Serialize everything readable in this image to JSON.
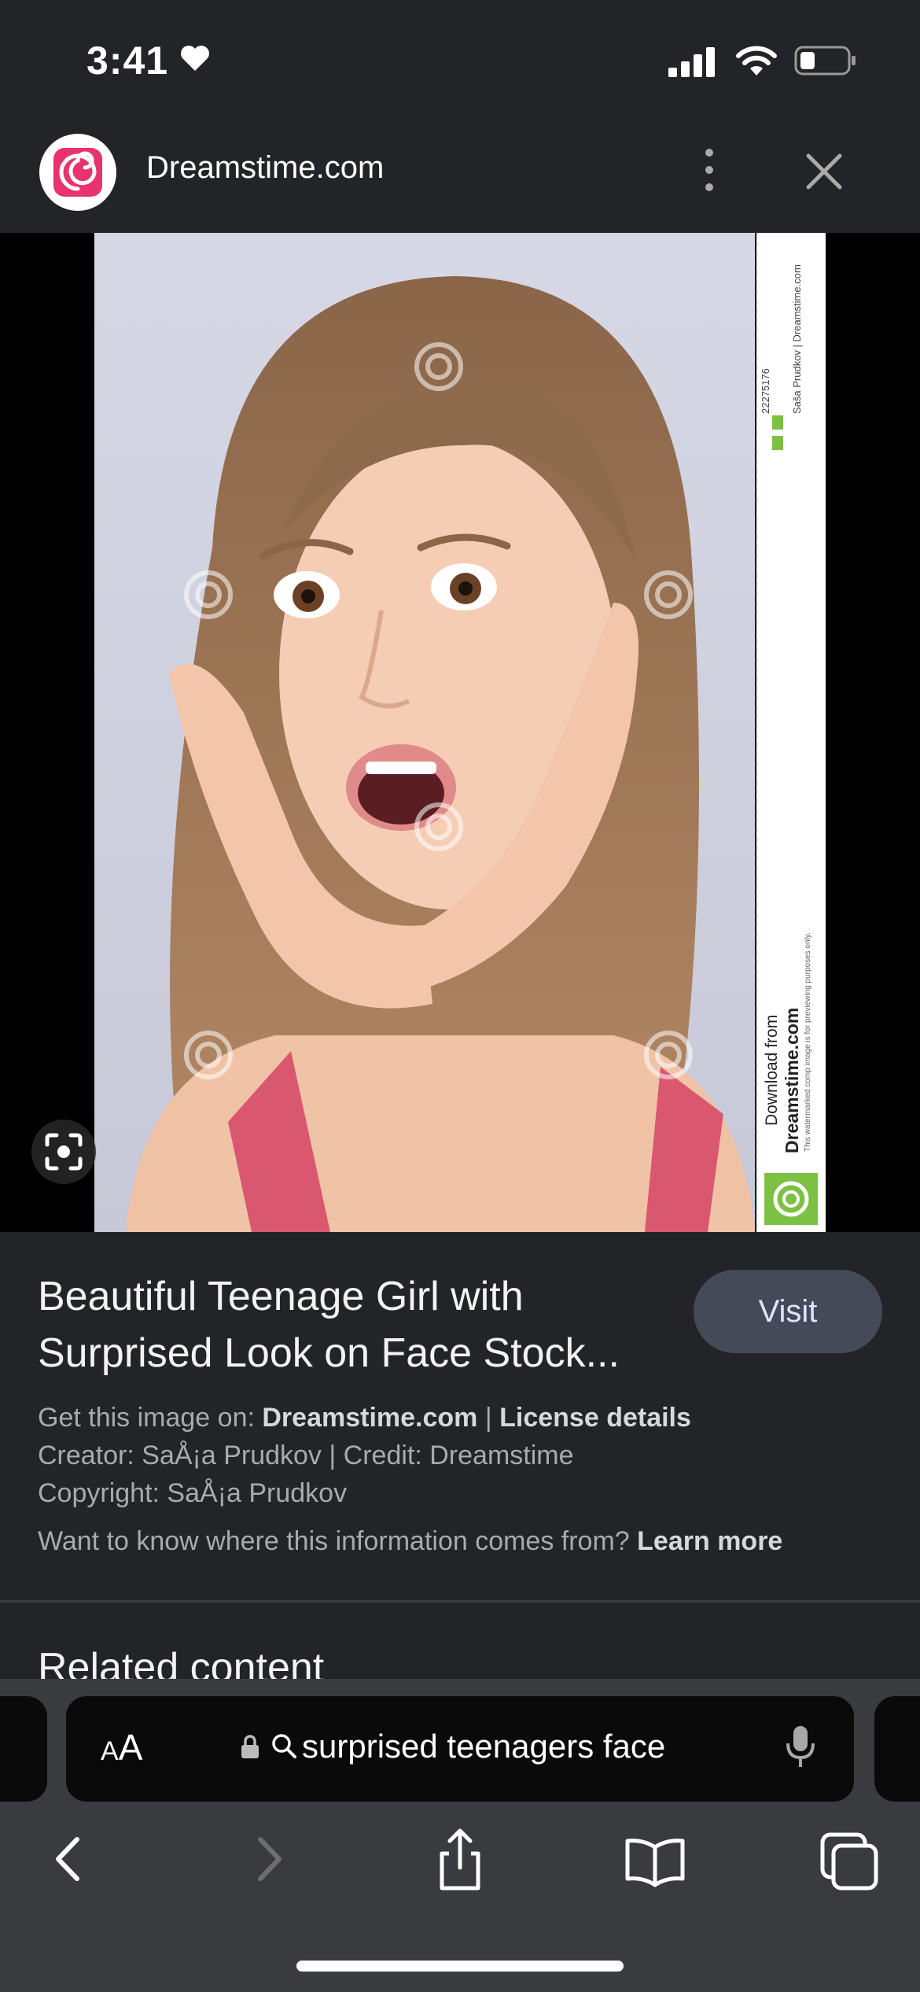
{
  "status_bar": {
    "time": "3:41",
    "icons": [
      "heart-icon",
      "cellular-signal-icon",
      "wifi-icon",
      "battery-icon"
    ]
  },
  "source": {
    "site_name": "Dreamstime.com",
    "logo_icon": "dreamstime-swirl-logo",
    "menu_icon": "more-vertical-icon",
    "close_icon": "close-icon"
  },
  "image": {
    "alt": "Beautiful Teenage Girl with Surprised Look on Face Stock",
    "watermark": "dreamstime",
    "side_strip": {
      "id": "22275176",
      "credit": "Saša Prudkov | Dreamstime.com",
      "download_line1": "Download from",
      "download_line2": "Dreamstime.com",
      "notice": "This watermarked comp image is for previewing purposes only."
    },
    "lens_icon": "visual-search-icon"
  },
  "result": {
    "title": "Beautiful Teenage Girl with Surprised Look on Face Stock...",
    "visit_label": "Visit",
    "get_image_prefix": "Get this image on: ",
    "get_image_site": "Dreamstime.com",
    "separator": " | ",
    "license_label": "License details",
    "creator_line": "Creator: SaÅ¡a Prudkov | Credit: Dreamstime",
    "copyright_line": "Copyright: SaÅ¡a Prudkov",
    "info_question": "Want to know where this information comes from? ",
    "learn_more": "Learn more",
    "related_heading": "Related content"
  },
  "browser": {
    "text_size_big": "A",
    "text_size_small": "A",
    "query": "surprised teenagers face",
    "toolbar_icons": [
      "back-icon",
      "forward-icon",
      "share-icon",
      "bookmarks-icon",
      "tabs-icon"
    ]
  },
  "colors": {
    "background": "#232427",
    "visit_button": "#454a59",
    "dreamstime_pink": "#e8336e",
    "dreamstime_green": "#7cc143"
  }
}
